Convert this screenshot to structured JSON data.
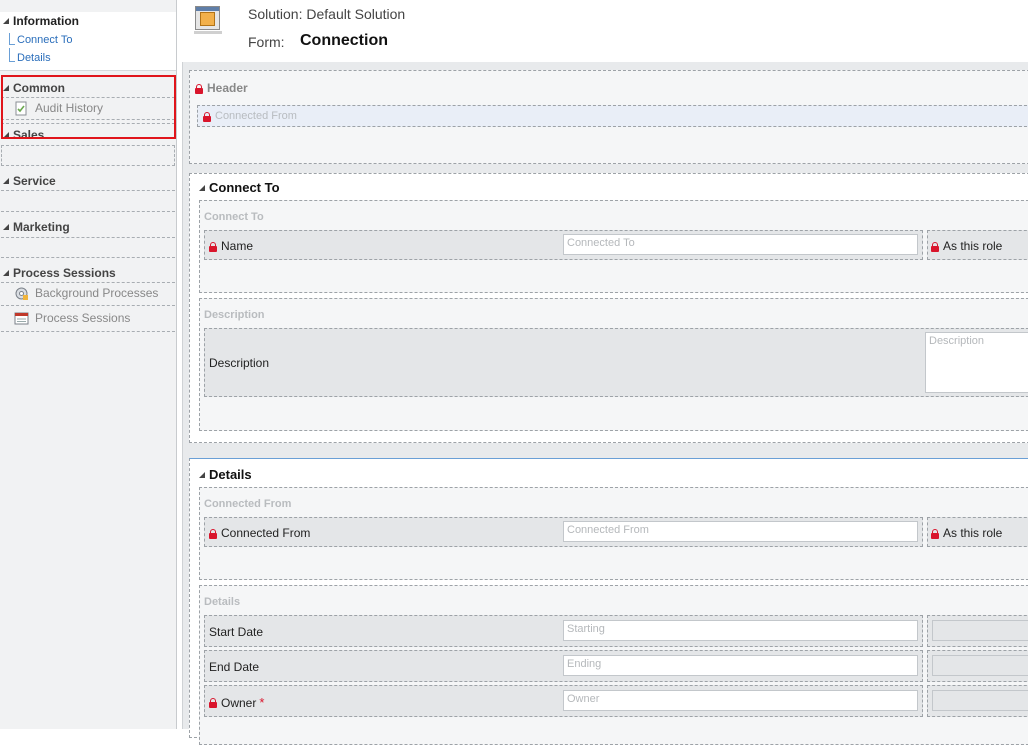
{
  "nav": {
    "information": {
      "heading": "Information",
      "links": [
        "Connect To",
        "Details"
      ]
    },
    "common": {
      "heading": "Common",
      "items": [
        {
          "label": "Audit History",
          "icon": "audit-history-icon"
        }
      ]
    },
    "sales": {
      "heading": "Sales"
    },
    "service": {
      "heading": "Service"
    },
    "marketing": {
      "heading": "Marketing"
    },
    "process_sessions": {
      "heading": "Process Sessions",
      "items": [
        {
          "label": "Background Processes",
          "icon": "background-processes-icon"
        },
        {
          "label": "Process Sessions",
          "icon": "process-sessions-icon"
        }
      ]
    }
  },
  "header": {
    "solution": "Solution: Default Solution",
    "form_label": "Form:",
    "form_name": "Connection"
  },
  "form": {
    "header_section": {
      "title": "Header",
      "field_placeholder": "Connected From"
    },
    "connect_to_tab": {
      "title": "Connect To",
      "section1": {
        "title": "Connect To",
        "name_label": "Name",
        "name_placeholder": "Connected To",
        "role_label": "As this role"
      },
      "section2": {
        "title": "Description",
        "desc_label": "Description",
        "desc_placeholder": "Description"
      }
    },
    "details_tab": {
      "title": "Details",
      "section1": {
        "title": "Connected From",
        "from_label": "Connected From",
        "from_placeholder": "Connected From",
        "role_label": "As this role"
      },
      "section2": {
        "title": "Details",
        "start_label": "Start Date",
        "start_placeholder": "Starting",
        "end_label": "End Date",
        "end_placeholder": "Ending",
        "owner_label": "Owner",
        "owner_required": "*",
        "owner_placeholder": "Owner"
      }
    }
  },
  "colors": {
    "link": "#2a6ebb",
    "highlight": "#e0151b",
    "lock": "#d9152c"
  }
}
